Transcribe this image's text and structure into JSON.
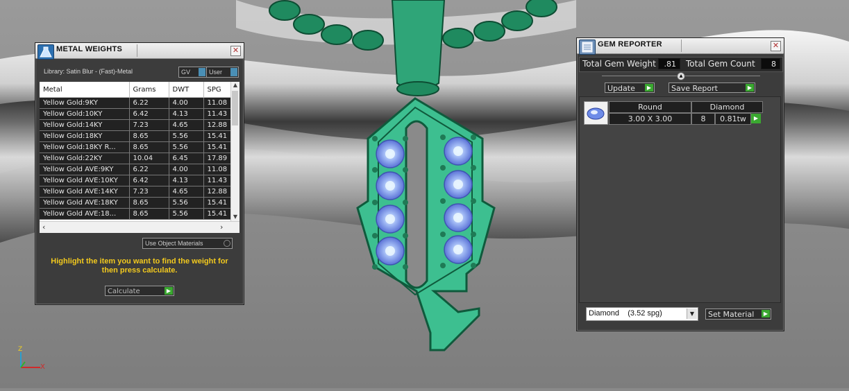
{
  "metal_weights": {
    "title": "METAL WEIGHTS",
    "library_label": "Library: Satin Blur - (Fast)-Metal",
    "toggle_gv": "GV",
    "toggle_user": "User",
    "columns": [
      "Metal",
      "Grams",
      "DWT",
      "SPG"
    ],
    "rows": [
      {
        "metal": "Yellow Gold:9KY",
        "grams": "6.22",
        "dwt": "4.00",
        "spg": "11.08"
      },
      {
        "metal": "Yellow Gold:10KY",
        "grams": "6.42",
        "dwt": "4.13",
        "spg": "11.43"
      },
      {
        "metal": "Yellow Gold:14KY",
        "grams": "7.23",
        "dwt": "4.65",
        "spg": "12.88"
      },
      {
        "metal": "Yellow Gold:18KY",
        "grams": "8.65",
        "dwt": "5.56",
        "spg": "15.41"
      },
      {
        "metal": "Yellow Gold:18KY R...",
        "grams": "8.65",
        "dwt": "5.56",
        "spg": "15.41"
      },
      {
        "metal": "Yellow Gold:22KY",
        "grams": "10.04",
        "dwt": "6.45",
        "spg": "17.89"
      },
      {
        "metal": "Yellow Gold AVE:9KY",
        "grams": "6.22",
        "dwt": "4.00",
        "spg": "11.08"
      },
      {
        "metal": "Yellow Gold AVE:10KY",
        "grams": "6.42",
        "dwt": "4.13",
        "spg": "11.43"
      },
      {
        "metal": "Yellow Gold AVE:14KY",
        "grams": "7.23",
        "dwt": "4.65",
        "spg": "12.88"
      },
      {
        "metal": "Yellow Gold AVE:18KY",
        "grams": "8.65",
        "dwt": "5.56",
        "spg": "15.41"
      },
      {
        "metal": "Yellow Gold AVE:18...",
        "grams": "8.65",
        "dwt": "5.56",
        "spg": "15.41"
      }
    ],
    "use_object_materials": "Use Object Materials",
    "instruction": "Highlight the item you want to find the weight for then press calculate.",
    "calculate_label": "Calculate"
  },
  "gem_reporter": {
    "title": "GEM REPORTER",
    "total_weight_label": "Total Gem Weight",
    "total_weight_value": ".81",
    "total_count_label": "Total Gem Count",
    "total_count_value": "8",
    "update_label": "Update",
    "save_report_label": "Save Report",
    "gem": {
      "shape": "Round",
      "material": "Diamond",
      "size": "3.00 X 3.00",
      "count": "8",
      "weight": "0.81tw"
    },
    "material_select": "Diamond    (3.52 spg)",
    "set_material_label": "Set Material"
  },
  "axes": {
    "z": "Z",
    "x": "X"
  },
  "colors": {
    "panel_bg": "#3c3c3c",
    "accent_green": "#3aa830",
    "pendant_green": "#3dbf90",
    "gem_blue": "#6e8ce8",
    "instruction_yellow": "#f2c91e"
  }
}
